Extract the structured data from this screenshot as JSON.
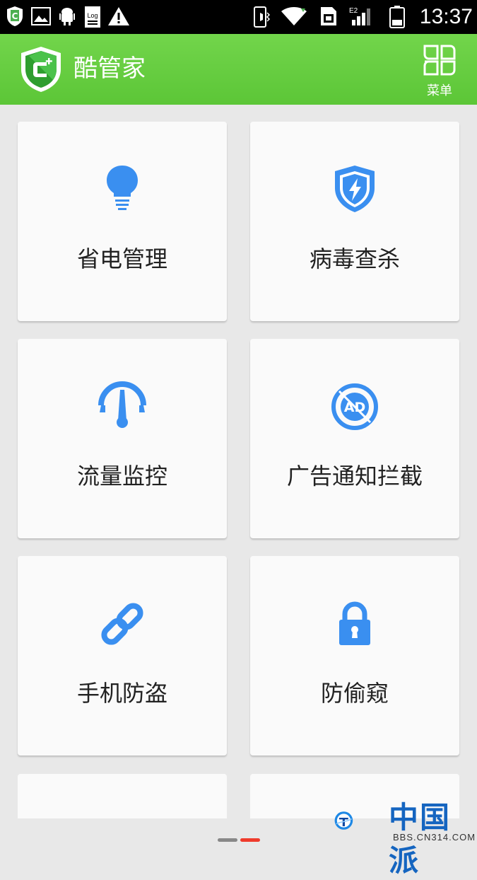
{
  "status_bar": {
    "time": "13:37",
    "icons": [
      "cool-manager-notification-icon",
      "gallery-icon",
      "android-debug-icon",
      "log-icon",
      "warning-icon",
      "vibrate-icon",
      "wifi-icon",
      "sim-icon",
      "signal-e2-icon",
      "battery-icon"
    ]
  },
  "app_bar": {
    "title": "酷管家",
    "menu_label": "菜单"
  },
  "features": [
    {
      "label": "省电管理",
      "icon": "lightbulb-icon"
    },
    {
      "label": "病毒查杀",
      "icon": "shield-bolt-icon"
    },
    {
      "label": "流量监控",
      "icon": "gauge-icon"
    },
    {
      "label": "广告通知拦截",
      "icon": "ad-block-icon"
    },
    {
      "label": "手机防盗",
      "icon": "chain-link-icon"
    },
    {
      "label": "防偷窥",
      "icon": "padlock-icon"
    }
  ],
  "colors": {
    "appbar_green": "#5cc637",
    "icon_blue": "#3a8ff0",
    "pager_inactive": "#888888",
    "pager_active": "#ef3b2c"
  },
  "watermark": {
    "text": "中国派",
    "url": "BBS.CN314.COM"
  }
}
